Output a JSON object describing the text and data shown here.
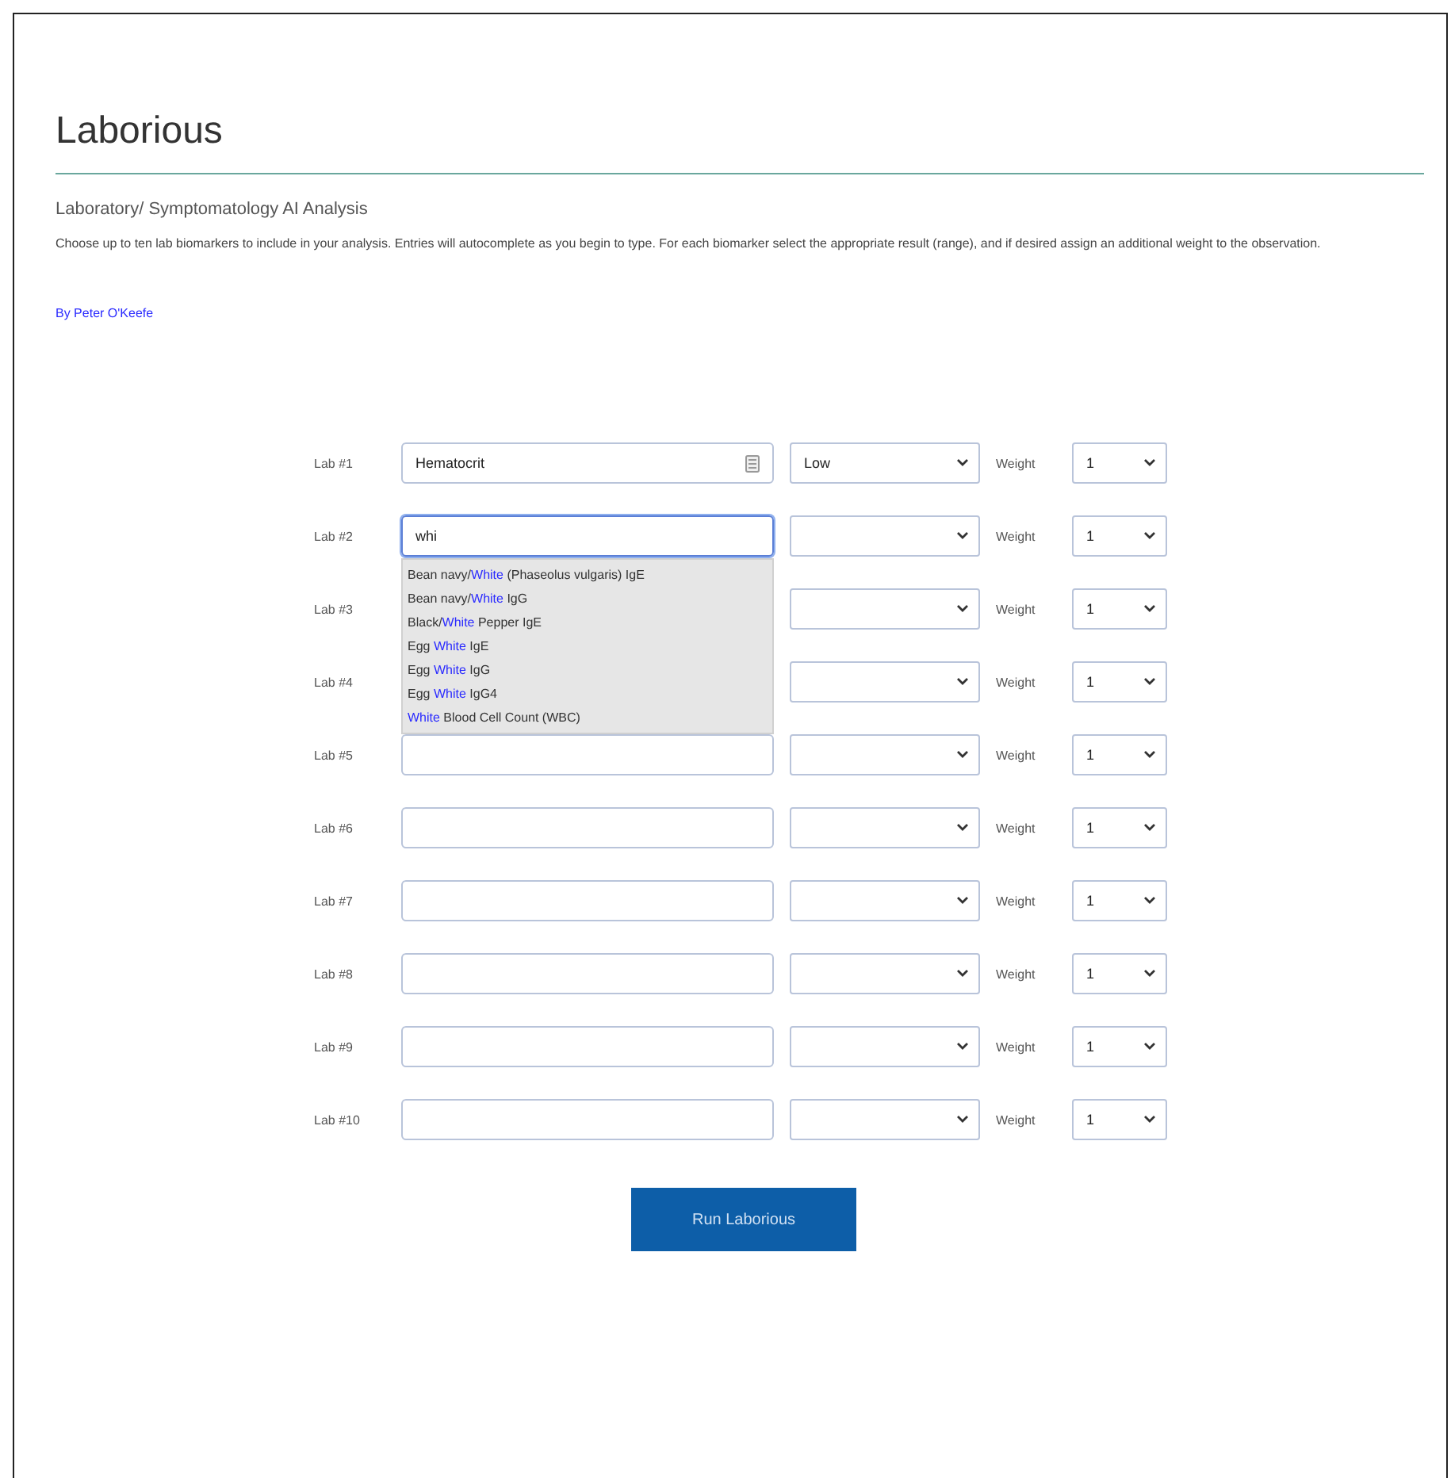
{
  "title": "Laborious",
  "subtitle": "Laboratory/ Symptomatology AI Analysis",
  "description": "Choose up to ten lab biomarkers to include in your analysis. Entries will autocomplete as you begin to type. For each biomarker select the appropriate result (range), and if desired assign an additional weight to the observation.",
  "byline": "By Peter O'Keefe",
  "rows": [
    {
      "label": "Lab #1",
      "value": "Hematocrit",
      "result": "Low",
      "weight_label": "Weight",
      "weight": "1",
      "focused": false,
      "has_card_icon": true
    },
    {
      "label": "Lab #2",
      "value": "whi",
      "result": "",
      "weight_label": "Weight",
      "weight": "1",
      "focused": true,
      "has_card_icon": false,
      "suggestions": [
        {
          "before": "Bean navy/",
          "match": "White",
          "after": " (Phaseolus vulgaris) IgE"
        },
        {
          "before": "Bean navy/",
          "match": "White",
          "after": " IgG"
        },
        {
          "before": "Black/",
          "match": "White",
          "after": " Pepper IgE"
        },
        {
          "before": "Egg ",
          "match": "White",
          "after": " IgE"
        },
        {
          "before": "Egg ",
          "match": "White",
          "after": " IgG"
        },
        {
          "before": "Egg ",
          "match": "White",
          "after": " IgG4"
        },
        {
          "match": "White",
          "after": " Blood Cell Count (WBC)"
        }
      ]
    },
    {
      "label": "Lab #3",
      "result": "",
      "weight_label": "Weight",
      "weight": "1",
      "has_card_icon": false
    },
    {
      "label": "Lab #4",
      "result": "",
      "weight_label": "Weight",
      "weight": "1",
      "has_card_icon": false
    },
    {
      "label": "Lab #5",
      "value": "",
      "result": "",
      "weight_label": "Weight",
      "weight": "1",
      "focused": false,
      "has_card_icon": false
    },
    {
      "label": "Lab #6",
      "value": "",
      "result": "",
      "weight_label": "Weight",
      "weight": "1",
      "focused": false,
      "has_card_icon": false
    },
    {
      "label": "Lab #7",
      "value": "",
      "result": "",
      "weight_label": "Weight",
      "weight": "1",
      "focused": false,
      "has_card_icon": false
    },
    {
      "label": "Lab #8",
      "value": "",
      "result": "",
      "weight_label": "Weight",
      "weight": "1",
      "focused": false,
      "has_card_icon": false
    },
    {
      "label": "Lab #9",
      "value": "",
      "result": "",
      "weight_label": "Weight",
      "weight": "1",
      "focused": false,
      "has_card_icon": false
    },
    {
      "label": "Lab #10",
      "value": "",
      "result": "",
      "weight_label": "Weight",
      "weight": "1",
      "focused": false,
      "has_card_icon": false
    }
  ],
  "submit": "Run Laborious"
}
